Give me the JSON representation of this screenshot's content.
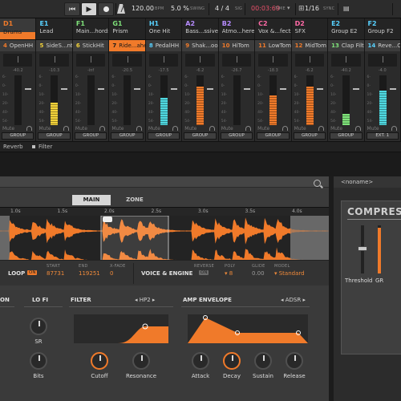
{
  "transport": {
    "tempo": "120.00",
    "tempo_label": "BPM",
    "swing": "5.0 %",
    "swing_label": "SWING",
    "signature": "4 / 4",
    "signature_label": "SIG",
    "time": "00:03:69",
    "time_label": "TIME",
    "quantize": "1/16",
    "sync_label": "SYNC"
  },
  "pads": [
    {
      "code": "D1",
      "name": "Drums",
      "code_color": "#f07a2a",
      "selected": true
    },
    {
      "code": "E1",
      "name": "Lead",
      "code_color": "#57d1ff"
    },
    {
      "code": "F1",
      "name": "Main...hords",
      "code_color": "#7fe27a"
    },
    {
      "code": "G1",
      "name": "Prism",
      "code_color": "#7fe27a"
    },
    {
      "code": "H1",
      "name": "One Hit",
      "code_color": "#57d1ff"
    },
    {
      "code": "A2",
      "name": "Bass...ssive",
      "code_color": "#b78cff"
    },
    {
      "code": "B2",
      "name": "Atmo...heres",
      "code_color": "#b78cff"
    },
    {
      "code": "C2",
      "name": "Vox &...fects",
      "code_color": "#ff6aa6"
    },
    {
      "code": "D2",
      "name": "SFX",
      "code_color": "#ff6aa6"
    },
    {
      "code": "E2",
      "name": "Group E2",
      "code_color": "#57d1ff"
    },
    {
      "code": "F2",
      "name": "Group F2",
      "code_color": "#57d1ff"
    }
  ],
  "strips": [
    {
      "num": "4",
      "name": "OpenHH",
      "num_color": "#f07a2a",
      "db": "-40.2",
      "meter": 0,
      "color": "#f07a2a",
      "route": "GROUP"
    },
    {
      "num": "5",
      "name": "SideS...ntral",
      "num_color": "#f3d23a",
      "db": "-10.3",
      "meter": 0.45,
      "color": "#f3d23a",
      "route": "GROUP"
    },
    {
      "num": "6",
      "name": "StickHit",
      "num_color": "#f3d23a",
      "db": "-inf",
      "meter": 0,
      "color": "#f3d23a",
      "route": "GROUP"
    },
    {
      "num": "7",
      "name": "Ride...ahead",
      "num_color": "#1a1a1a",
      "db": "-20.5",
      "meter": 0,
      "color": "#f07a2a",
      "route": "GROUP",
      "selected": true
    },
    {
      "num": "8",
      "name": "PedalHH",
      "num_color": "#57d1ff",
      "db": "-17.5",
      "meter": 0.55,
      "color": "#4fd8e0",
      "route": "GROUP"
    },
    {
      "num": "9",
      "name": "Shak...oogle",
      "num_color": "#f07a2a",
      "db": "-6.2",
      "meter": 0.78,
      "color": "#f07a2a",
      "route": "GROUP"
    },
    {
      "num": "10",
      "name": "HiTom",
      "num_color": "#f07a2a",
      "db": "-26.7",
      "meter": 0,
      "color": "#f07a2a",
      "route": "GROUP"
    },
    {
      "num": "11",
      "name": "LowTom",
      "num_color": "#f07a2a",
      "db": "-18.3",
      "meter": 0.6,
      "color": "#f07a2a",
      "route": "GROUP"
    },
    {
      "num": "12",
      "name": "MidTom",
      "num_color": "#f07a2a",
      "db": "-6.2",
      "meter": 0.78,
      "color": "#f07a2a",
      "route": "GROUP"
    },
    {
      "num": "13",
      "name": "Clap Filthy",
      "num_color": "#7fe27a",
      "db": "-40.2",
      "meter": 0.22,
      "color": "#7fe27a",
      "route": "GROUP"
    },
    {
      "num": "14",
      "name": "Reve...Crash",
      "num_color": "#57d1ff",
      "db": "-4.0",
      "meter": 0.7,
      "color": "#4fd8e0",
      "route": "EXT. 1"
    }
  ],
  "strip_scale": [
    "6-",
    "0-",
    "10-",
    "20-",
    "40-",
    "54-"
  ],
  "strip_mute": "Mute",
  "fx": {
    "reverb": "Reverb",
    "filter": "Filter"
  },
  "sampler": {
    "tab_main": "MAIN",
    "tab_zone": "ZONE",
    "timeline": [
      "1.0s",
      "1.5s",
      "2.0s",
      "2.5s",
      "3.0s",
      "3.5s",
      "4.0s"
    ],
    "loop": {
      "title": "LOOP",
      "on": "ON",
      "start_label": "START",
      "start": "87731",
      "end_label": "END",
      "end": "119251",
      "xfade_label": "X-FADE",
      "xfade": "0"
    },
    "voice": {
      "title": "VOICE & ENGINE",
      "reverse_label": "REVERSE",
      "reverse": "ON",
      "poly_label": "POLY",
      "poly": "▾ 8",
      "glide_label": "GLIDE",
      "glide": "0.00",
      "model_label": "MODEL",
      "model": "▾ Standard"
    },
    "modules": {
      "left_cut": "ON",
      "lofi": "LO FI",
      "sr": "SR",
      "bits": "Bits",
      "filter": "FILTER",
      "filter_type": "HP2",
      "cutoff": "Cutoff",
      "resonance": "Resonance",
      "amp": "AMP ENVELOPE",
      "amp_type": "ADSR",
      "attack": "Attack",
      "decay": "Decay",
      "sustain": "Sustain",
      "release": "Release"
    }
  },
  "compressor": {
    "preset": "<noname>",
    "title": "COMPRESS",
    "threshold": "Threshold",
    "gr": "GR",
    "threshold_level": 0.3,
    "gr_level": 0.95
  }
}
